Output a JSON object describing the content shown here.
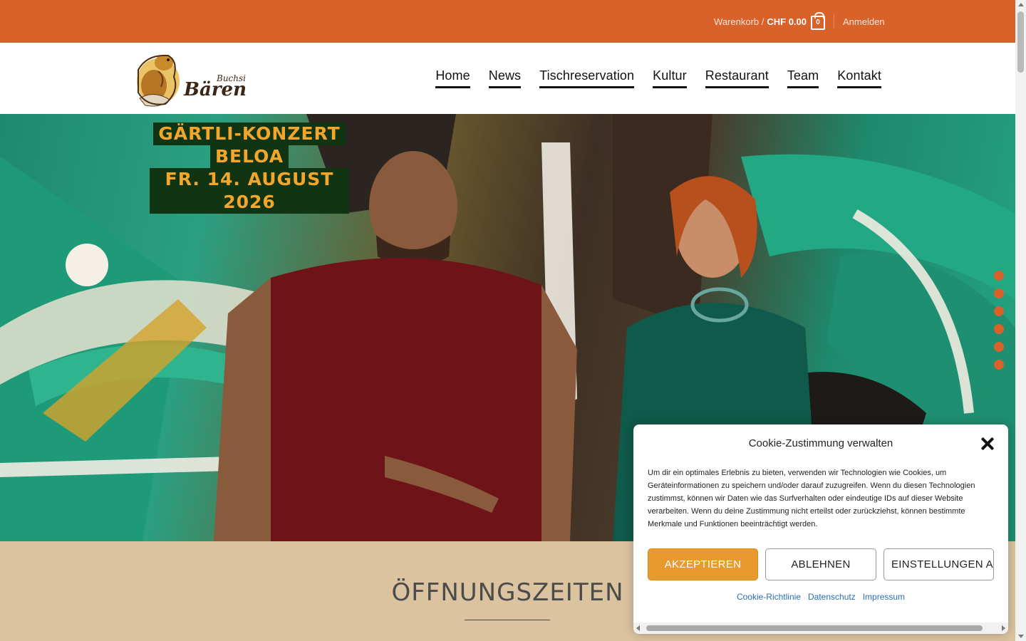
{
  "topbar": {
    "cart_label": "Warenkorb /",
    "cart_total": "CHF 0.00",
    "cart_count": "0",
    "login_label": "Anmelden"
  },
  "header": {
    "logo_alt": "Buchsi Bären",
    "nav": [
      {
        "label": "Home"
      },
      {
        "label": "News"
      },
      {
        "label": "Tischreservation"
      },
      {
        "label": "Kultur"
      },
      {
        "label": "Restaurant"
      },
      {
        "label": "Team"
      },
      {
        "label": "Kontakt"
      }
    ]
  },
  "hero": {
    "line1": "GÄRTLI-KONZERT",
    "line2": "BELOA",
    "line3": "FR. 14. AUGUST 2026",
    "slide_count": 6
  },
  "hours": {
    "title": "ÖFFNUNGSZEITEN"
  },
  "cookie": {
    "title": "Cookie-Zustimmung verwalten",
    "text": "Um dir ein optimales Erlebnis zu bieten, verwenden wir Technologien wie Cookies, um Geräteinformationen zu speichern und/oder darauf zuzugreifen. Wenn du diesen Technologien zustimmst, können wir Daten wie das Surfverhalten oder eindeutige IDs auf dieser Website verarbeiten. Wenn du deine Zustimmung nicht erteilst oder zurückziehst, können bestimmte Merkmale und Funktionen beeinträchtigt werden.",
    "accept_label": "AKZEPTIEREN",
    "deny_label": "ABLEHNEN",
    "prefs_label": "EINSTELLUNGEN ANSEHEN",
    "links": [
      "Cookie-Richtlinie",
      "Datenschutz",
      "Impressum"
    ]
  },
  "colors": {
    "brand_orange": "#d9612a",
    "accent_gold": "#f3a62a",
    "hero_title_bg": "#113412",
    "hours_bg": "#dbc3a0",
    "accept_button": "#e89a2f"
  }
}
